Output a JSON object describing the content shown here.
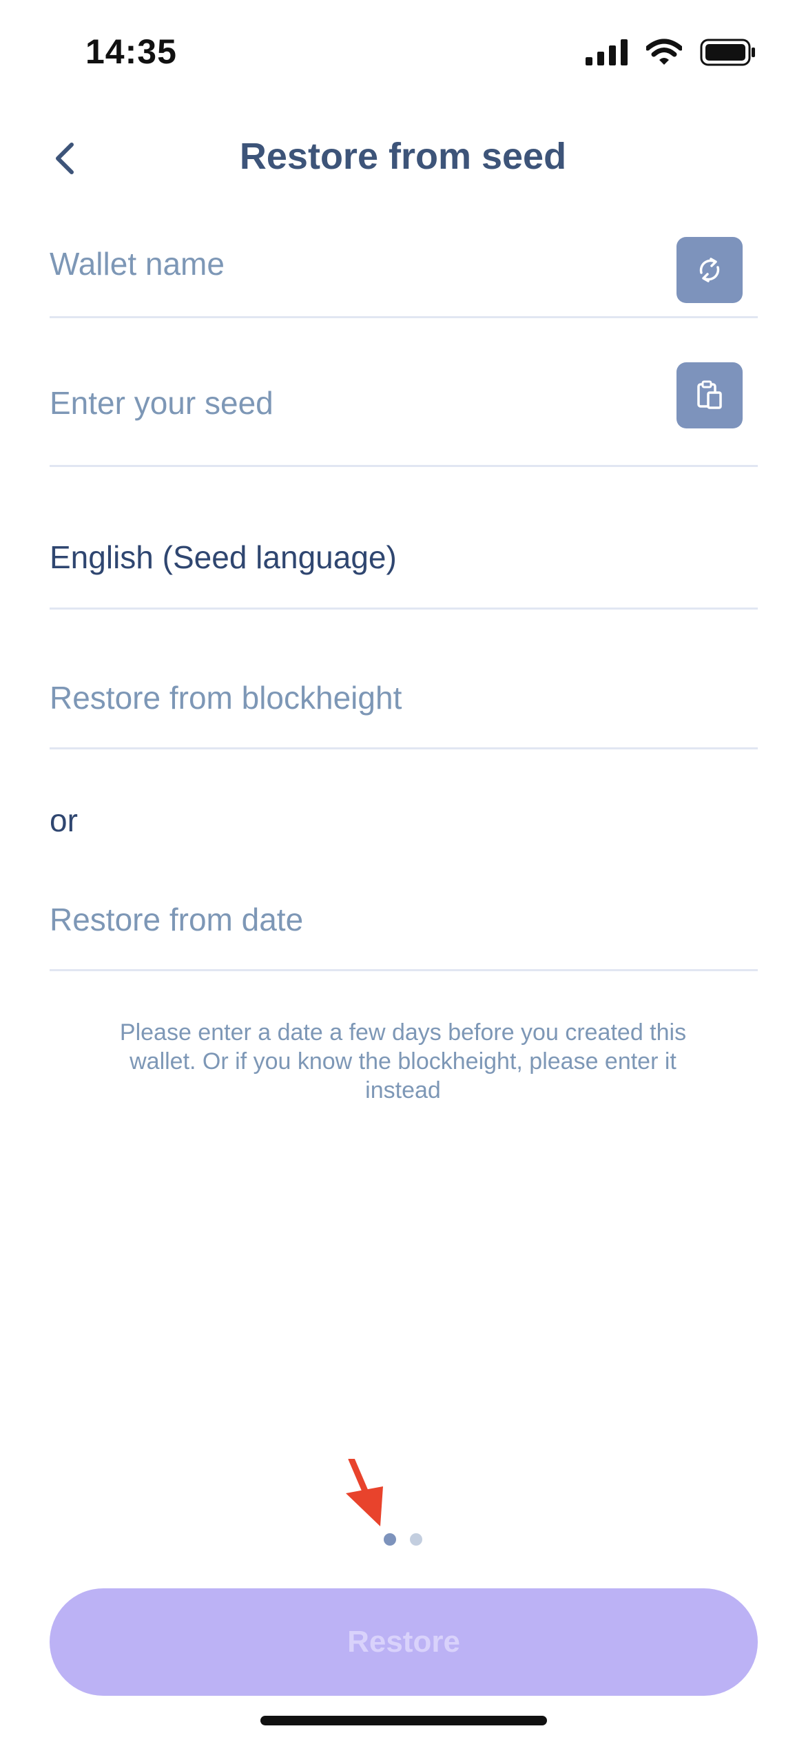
{
  "status_bar": {
    "time": "14:35"
  },
  "header": {
    "title": "Restore from seed",
    "back_icon": "chevron-left-icon"
  },
  "form": {
    "wallet_name": {
      "placeholder": "Wallet name",
      "icon": "refresh-icon"
    },
    "seed": {
      "placeholder": "Enter your seed",
      "icon": "paste-clipboard-icon"
    },
    "seed_language": {
      "value": "English (Seed language)"
    },
    "blockheight": {
      "placeholder": "Restore from blockheight"
    },
    "or_label": "or",
    "date": {
      "placeholder": "Restore from date"
    },
    "hint": "Please enter a date a few days before you created this wallet. Or if you know the blockheight, please enter it instead"
  },
  "pager": {
    "count": 2,
    "active_index": 0
  },
  "restore_button": {
    "label": "Restore",
    "enabled": false
  },
  "colors": {
    "title": "#3d5479",
    "placeholder": "#7d97b6",
    "icon_button": "#7d93bc",
    "restore_button_disabled": "#bcb2f5",
    "dot_active": "#7d93bc",
    "dot_inactive": "#c3cedf",
    "annotation_arrow": "#e8432c"
  }
}
